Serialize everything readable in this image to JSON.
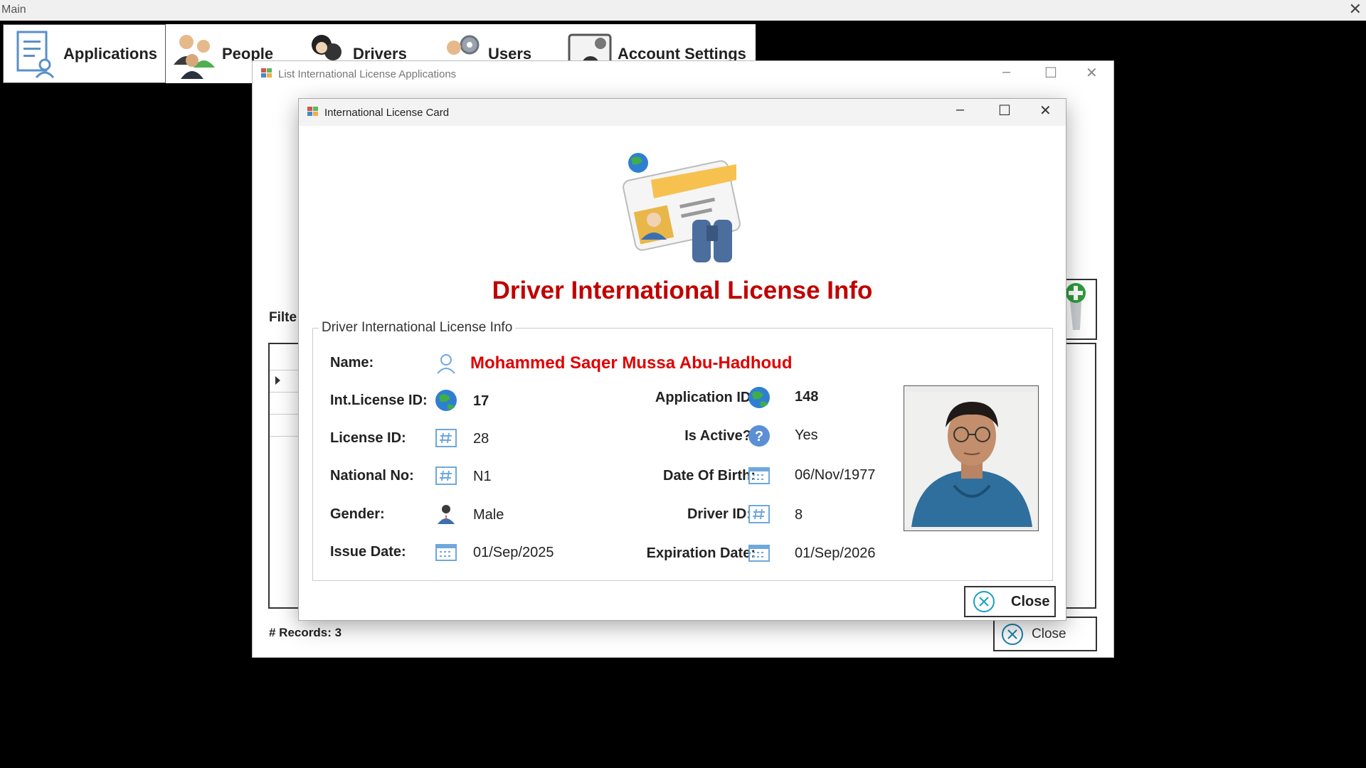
{
  "main_window": {
    "title": "Main"
  },
  "menu": {
    "items": [
      {
        "label": "Applications",
        "icon": "applications-icon",
        "selected": true
      },
      {
        "label": "People",
        "icon": "people-icon"
      },
      {
        "label": "Drivers",
        "icon": "drivers-icon"
      },
      {
        "label": "Users",
        "icon": "users-icon"
      },
      {
        "label": "Account Settings",
        "icon": "account-settings-icon"
      }
    ]
  },
  "list_window": {
    "title": "List International License Applications",
    "filter_label": "Filte",
    "records_label": "# Records: 3",
    "close_label": "Close"
  },
  "card_dialog": {
    "title": "International License Card",
    "heading": "Driver International License Info",
    "group_title": "Driver International License Info",
    "fields": {
      "name": {
        "label": "Name:",
        "value": "Mohammed Saqer Mussa Abu-Hadhoud"
      },
      "int_license_id": {
        "label": "Int.License ID:",
        "value": "17"
      },
      "license_id": {
        "label": "License ID:",
        "value": "28"
      },
      "national_no": {
        "label": "National No:",
        "value": "N1"
      },
      "gender": {
        "label": "Gender:",
        "value": "Male"
      },
      "issue_date": {
        "label": "Issue Date:",
        "value": "01/Sep/2025"
      },
      "application_id": {
        "label": "Application ID:",
        "value": "148"
      },
      "is_active": {
        "label": "Is Active?",
        "value": "Yes"
      },
      "date_of_birth": {
        "label": "Date Of Birth:",
        "value": "06/Nov/1977"
      },
      "driver_id": {
        "label": "Driver ID:",
        "value": "8"
      },
      "expiration_date": {
        "label": "Expiration Date:",
        "value": "01/Sep/2026"
      }
    },
    "close_label": "Close"
  },
  "colors": {
    "heading_red": "#c00000",
    "name_red": "#e00000"
  }
}
